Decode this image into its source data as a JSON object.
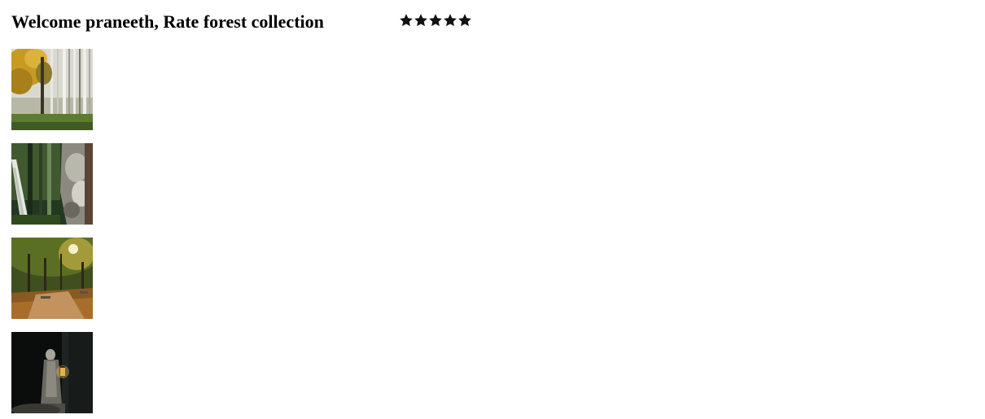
{
  "header": {
    "title": "Welcome praneeth, Rate forest collection"
  },
  "rating": {
    "value": 5,
    "max": 5,
    "star_color": "#111111",
    "star_icon": "star-icon"
  },
  "gallery": {
    "images": [
      {
        "name": "forest-autumn-birch-image"
      },
      {
        "name": "forest-tree-bark-image"
      },
      {
        "name": "forest-park-sunlight-image"
      },
      {
        "name": "forest-dark-lantern-figure-image"
      }
    ]
  }
}
